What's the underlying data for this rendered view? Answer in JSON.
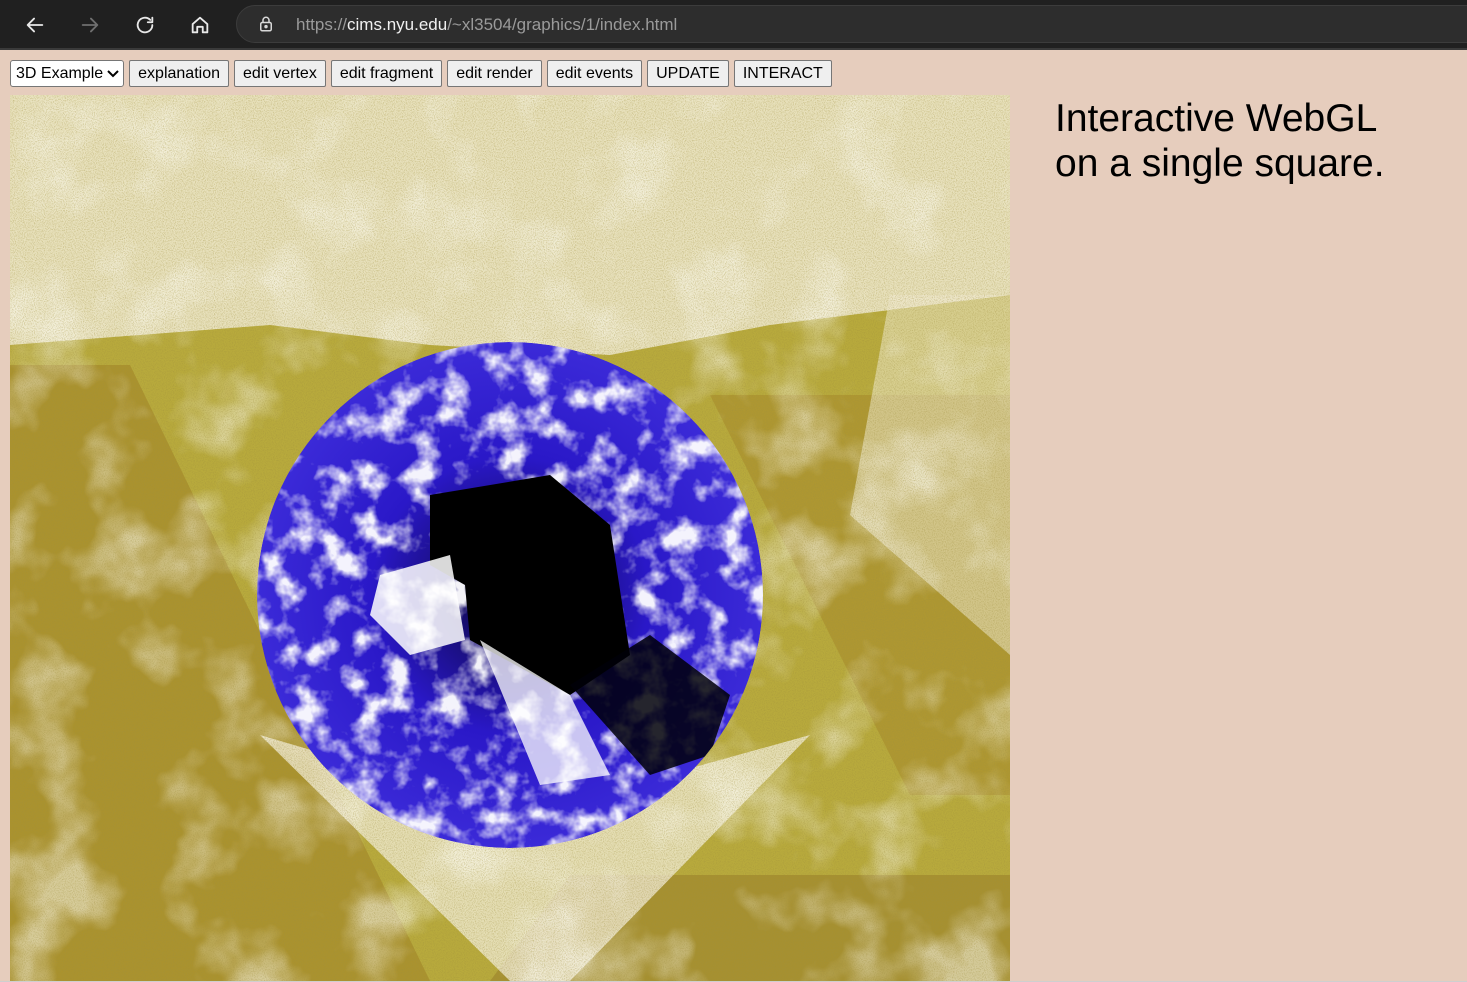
{
  "browser": {
    "url_prefix": "https://",
    "url_host": "cims.nyu.edu",
    "url_path": "/~xl3504/graphics/1/index.html"
  },
  "toolbar": {
    "example_select": "3D Example",
    "buttons": [
      "explanation",
      "edit vertex",
      "edit fragment",
      "edit render",
      "edit events",
      "UPDATE",
      "INTERACT"
    ]
  },
  "canvas": {
    "background_color": "#b8aa3c",
    "sphere_color": "#2a18c8"
  },
  "side": {
    "title_line1": "Interactive WebGL",
    "title_line2": "on a single square."
  }
}
